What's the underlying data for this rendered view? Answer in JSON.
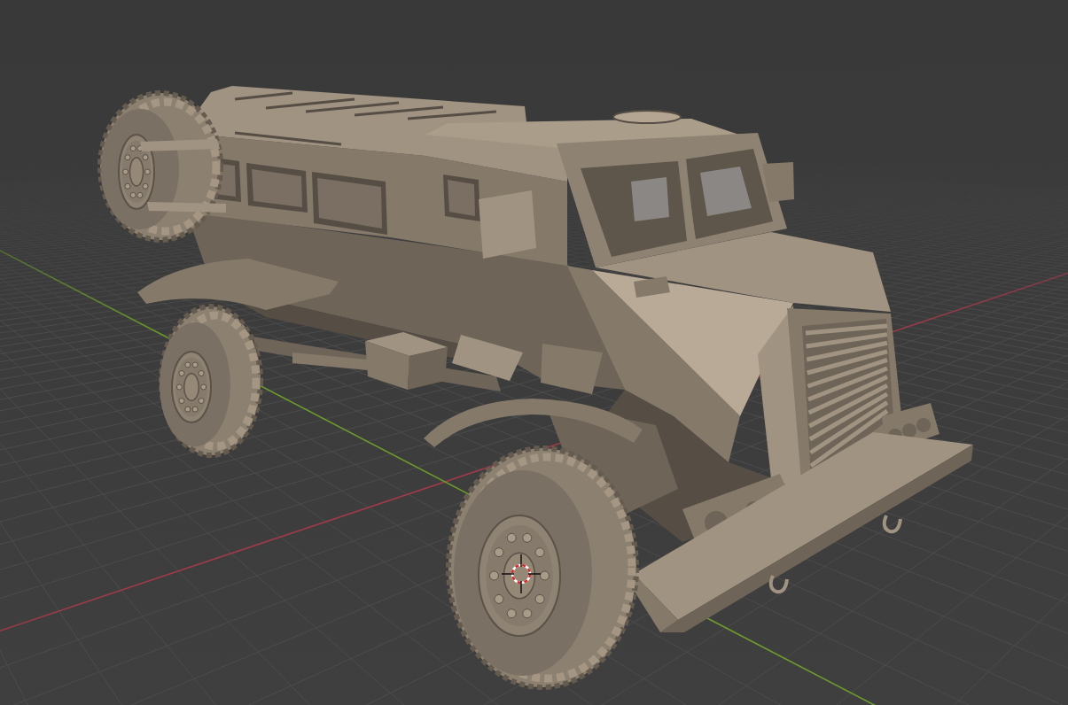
{
  "viewport": {
    "grid": true,
    "axes": [
      {
        "color": "#a03b4b"
      },
      {
        "color": "#6c9b2d"
      }
    ],
    "cursor_3d": true
  }
}
